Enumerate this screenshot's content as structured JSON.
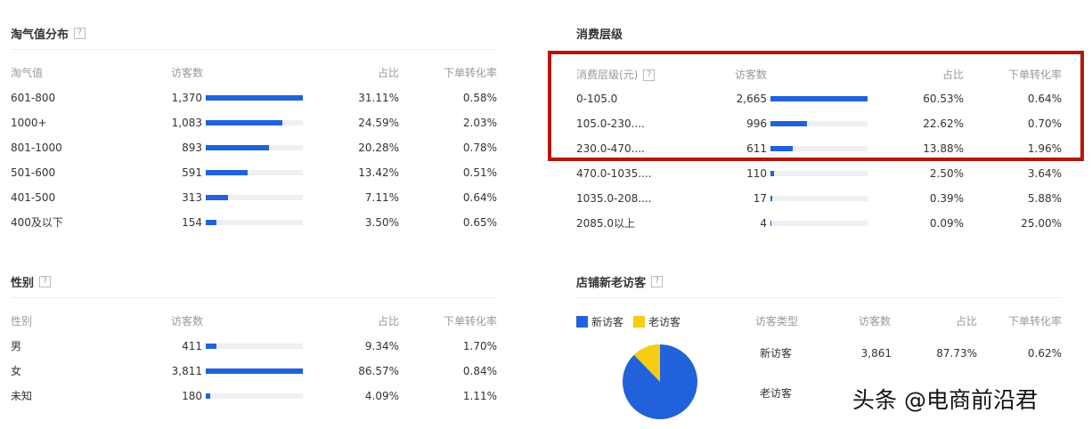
{
  "taoqi": {
    "title": "淘气值分布",
    "help": "?",
    "headers": [
      "淘气值",
      "访客数",
      "占比",
      "下单转化率"
    ],
    "rows": [
      {
        "label": "601-800",
        "visitors": "1,370",
        "share": "31.11%",
        "conversion": "0.58%",
        "bar_fraction": 1.0
      },
      {
        "label": "1000+",
        "visitors": "1,083",
        "share": "24.59%",
        "conversion": "2.03%",
        "bar_fraction": 0.79
      },
      {
        "label": "801-1000",
        "visitors": "893",
        "share": "20.28%",
        "conversion": "0.78%",
        "bar_fraction": 0.652
      },
      {
        "label": "501-600",
        "visitors": "591",
        "share": "13.42%",
        "conversion": "0.51%",
        "bar_fraction": 0.431
      },
      {
        "label": "401-500",
        "visitors": "313",
        "share": "7.11%",
        "conversion": "0.64%",
        "bar_fraction": 0.228
      },
      {
        "label": "400及以下",
        "visitors": "154",
        "share": "3.50%",
        "conversion": "0.65%",
        "bar_fraction": 0.112
      }
    ]
  },
  "consumption": {
    "title": "消费层级",
    "help": "?",
    "headers": [
      "消费层级(元)",
      "访客数",
      "占比",
      "下单转化率"
    ],
    "rows": [
      {
        "label": "0-105.0",
        "visitors": "2,665",
        "share": "60.53%",
        "conversion": "0.64%",
        "bar_fraction": 1.0
      },
      {
        "label": "105.0-230....",
        "visitors": "996",
        "share": "22.62%",
        "conversion": "0.70%",
        "bar_fraction": 0.374
      },
      {
        "label": "230.0-470....",
        "visitors": "611",
        "share": "13.88%",
        "conversion": "1.96%",
        "bar_fraction": 0.229
      },
      {
        "label": "470.0-1035....",
        "visitors": "110",
        "share": "2.50%",
        "conversion": "3.64%",
        "bar_fraction": 0.041
      },
      {
        "label": "1035.0-208....",
        "visitors": "17",
        "share": "0.39%",
        "conversion": "5.88%",
        "bar_fraction": 0.006
      },
      {
        "label": "2085.0以上",
        "visitors": "4",
        "share": "0.09%",
        "conversion": "25.00%",
        "bar_fraction": 0.0
      }
    ]
  },
  "gender": {
    "title": "性别",
    "help": "?",
    "headers": [
      "性别",
      "访客数",
      "占比",
      "下单转化率"
    ],
    "rows": [
      {
        "label": "男",
        "visitors": "411",
        "share": "9.34%",
        "conversion": "1.70%",
        "bar_fraction": 0.108
      },
      {
        "label": "女",
        "visitors": "3,811",
        "share": "86.57%",
        "conversion": "0.84%",
        "bar_fraction": 1.0
      },
      {
        "label": "未知",
        "visitors": "180",
        "share": "4.09%",
        "conversion": "1.11%",
        "bar_fraction": 0.047
      }
    ]
  },
  "newold": {
    "title": "店铺新老访客",
    "help": "?",
    "legend": [
      {
        "label": "新访客",
        "color": "#2162dc"
      },
      {
        "label": "老访客",
        "color": "#f5cd12"
      }
    ],
    "headers": [
      "访客类型",
      "访客数",
      "占比",
      "下单转化率"
    ],
    "rows": [
      {
        "label": "新访客",
        "visitors": "3,861",
        "share": "87.73%",
        "conversion": "0.62%"
      },
      {
        "label": "老访客",
        "visitors": "",
        "share": "",
        "conversion": ""
      }
    ],
    "pie_share_new": 0.8773
  },
  "colors": {
    "bar": "#2162dc",
    "bar_track": "#eff0f3",
    "highlight": "#b4160d",
    "old_visitor": "#f5cd12"
  },
  "watermark": "头条 @电商前沿君"
}
